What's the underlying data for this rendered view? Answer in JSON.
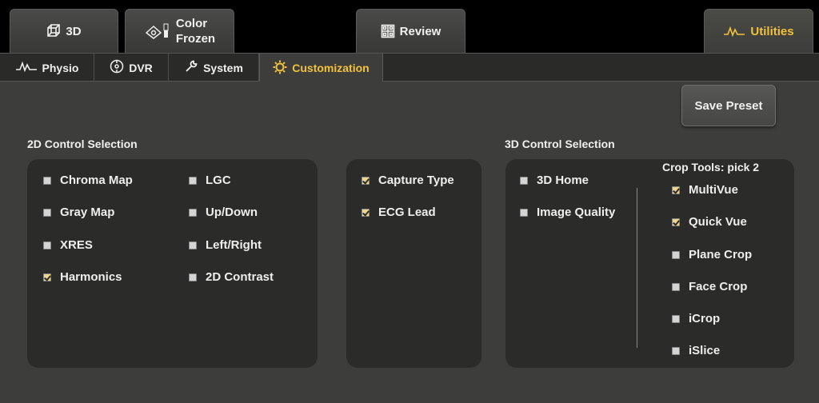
{
  "top_tabs": {
    "tab_3d": "3D",
    "color_frozen": {
      "line1": "Color",
      "line2": "Frozen"
    },
    "review": "Review",
    "utilities": "Utilities"
  },
  "sub_tabs": {
    "physio": "Physio",
    "dvr": "DVR",
    "system": "System",
    "customization": "Customization"
  },
  "save_preset_label": "Save Preset",
  "section_2d": {
    "title": "2D Control Selection",
    "col1": [
      {
        "label": "Chroma Map",
        "checked": false
      },
      {
        "label": "Gray Map",
        "checked": false
      },
      {
        "label": "XRES",
        "checked": false
      },
      {
        "label": "Harmonics",
        "checked": true
      }
    ],
    "col2": [
      {
        "label": "LGC",
        "checked": false
      },
      {
        "label": "Up/Down",
        "checked": false
      },
      {
        "label": "Left/Right",
        "checked": false
      },
      {
        "label": "2D Contrast",
        "checked": false
      }
    ],
    "extra": [
      {
        "label": "Capture Type",
        "checked": true
      },
      {
        "label": "ECG Lead",
        "checked": true
      }
    ]
  },
  "section_3d": {
    "title": "3D Control Selection",
    "items": [
      {
        "label": "3D Home",
        "checked": false
      },
      {
        "label": "Image Quality",
        "checked": false
      }
    ],
    "crop_title": "Crop Tools: pick 2",
    "crop_items": [
      {
        "label": "MultiVue",
        "checked": true
      },
      {
        "label": "Quick Vue",
        "checked": true
      },
      {
        "label": "Plane Crop",
        "checked": false
      },
      {
        "label": "Face Crop",
        "checked": false
      },
      {
        "label": "iCrop",
        "checked": false
      },
      {
        "label": "iSlice",
        "checked": false
      }
    ]
  },
  "colors": {
    "accent": "#f2c23a",
    "panel": "#2b2b2a",
    "background": "#3d3d3b"
  }
}
